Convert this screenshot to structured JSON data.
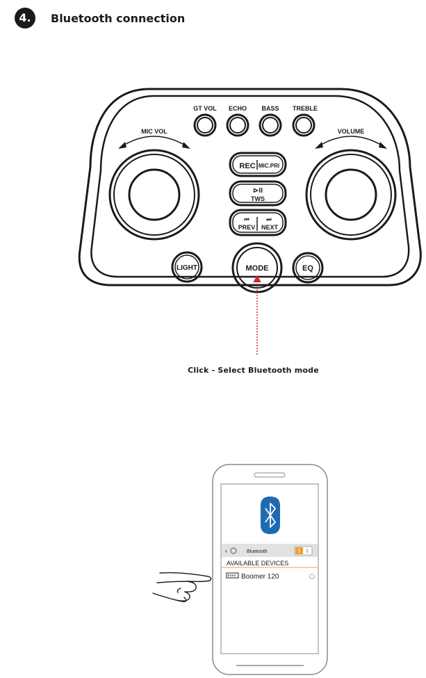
{
  "header": {
    "step_number": "4.",
    "title": "Bluetooth connection"
  },
  "speaker": {
    "knob_labels": [
      "GT VOL",
      "ECHO",
      "BASS",
      "TREBLE"
    ],
    "mic_vol_label": "MIC VOL",
    "volume_label": "VOLUME",
    "rec_label": "REC",
    "mic_pri_label": "MIC.PRI",
    "play_icon": "⊳II",
    "tws_label": "TWS",
    "prev_icon": "⏮",
    "next_icon": "⏭",
    "prev_label": "PREV",
    "next_label": "NEXT",
    "light_label": "LIGHT",
    "mode_label": "MODE",
    "eq_label": "EQ"
  },
  "instruction": {
    "caption": "Click - Select Bluetooth mode"
  },
  "phone": {
    "settings_title": "Bluetooth",
    "section_header": "AVAILABLE DEVICES",
    "device_name": "Boomer 120",
    "toggle_state": "on",
    "accent_color": "#f0a030",
    "bluetooth_color": "#1f6ab3"
  }
}
